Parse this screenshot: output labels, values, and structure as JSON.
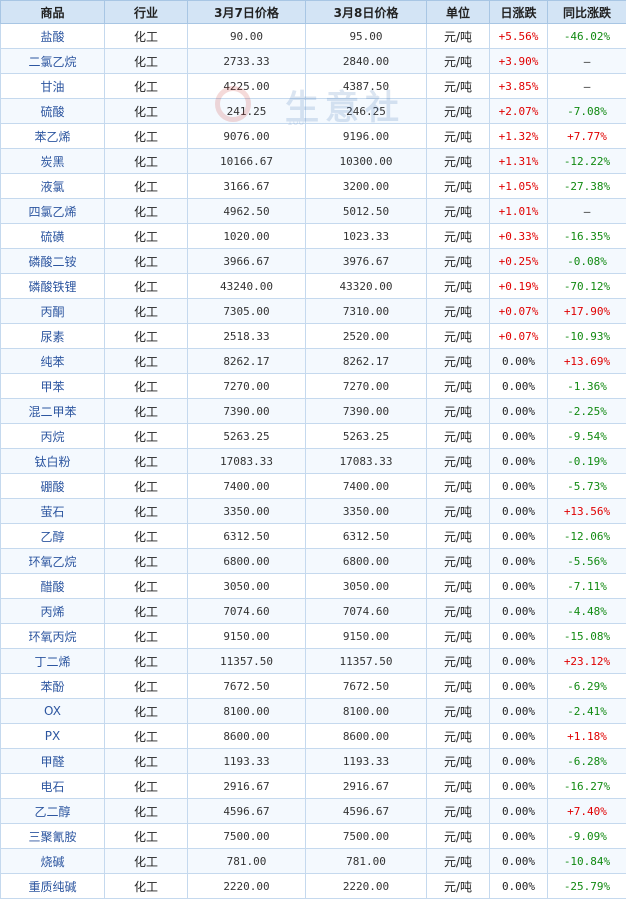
{
  "headers": [
    "商品",
    "行业",
    "3月7日价格",
    "3月8日价格",
    "单位",
    "日涨跌",
    "同比涨跌"
  ],
  "watermark": {
    "text": "生意社",
    "url": "100"
  },
  "rows": [
    {
      "name": "盐酸",
      "industry": "化工",
      "p1": "90.00",
      "p2": "95.00",
      "unit": "元/吨",
      "day": "+5.56%",
      "yoy": "-46.02%"
    },
    {
      "name": "二氯乙烷",
      "industry": "化工",
      "p1": "2733.33",
      "p2": "2840.00",
      "unit": "元/吨",
      "day": "+3.90%",
      "yoy": "—"
    },
    {
      "name": "甘油",
      "industry": "化工",
      "p1": "4225.00",
      "p2": "4387.50",
      "unit": "元/吨",
      "day": "+3.85%",
      "yoy": "—"
    },
    {
      "name": "硫酸",
      "industry": "化工",
      "p1": "241.25",
      "p2": "246.25",
      "unit": "元/吨",
      "day": "+2.07%",
      "yoy": "-7.08%"
    },
    {
      "name": "苯乙烯",
      "industry": "化工",
      "p1": "9076.00",
      "p2": "9196.00",
      "unit": "元/吨",
      "day": "+1.32%",
      "yoy": "+7.77%"
    },
    {
      "name": "炭黑",
      "industry": "化工",
      "p1": "10166.67",
      "p2": "10300.00",
      "unit": "元/吨",
      "day": "+1.31%",
      "yoy": "-12.22%"
    },
    {
      "name": "液氯",
      "industry": "化工",
      "p1": "3166.67",
      "p2": "3200.00",
      "unit": "元/吨",
      "day": "+1.05%",
      "yoy": "-27.38%"
    },
    {
      "name": "四氯乙烯",
      "industry": "化工",
      "p1": "4962.50",
      "p2": "5012.50",
      "unit": "元/吨",
      "day": "+1.01%",
      "yoy": "—"
    },
    {
      "name": "硫磺",
      "industry": "化工",
      "p1": "1020.00",
      "p2": "1023.33",
      "unit": "元/吨",
      "day": "+0.33%",
      "yoy": "-16.35%"
    },
    {
      "name": "磷酸二铵",
      "industry": "化工",
      "p1": "3966.67",
      "p2": "3976.67",
      "unit": "元/吨",
      "day": "+0.25%",
      "yoy": "-0.08%"
    },
    {
      "name": "磷酸铁锂",
      "industry": "化工",
      "p1": "43240.00",
      "p2": "43320.00",
      "unit": "元/吨",
      "day": "+0.19%",
      "yoy": "-70.12%"
    },
    {
      "name": "丙酮",
      "industry": "化工",
      "p1": "7305.00",
      "p2": "7310.00",
      "unit": "元/吨",
      "day": "+0.07%",
      "yoy": "+17.90%"
    },
    {
      "name": "尿素",
      "industry": "化工",
      "p1": "2518.33",
      "p2": "2520.00",
      "unit": "元/吨",
      "day": "+0.07%",
      "yoy": "-10.93%"
    },
    {
      "name": "纯苯",
      "industry": "化工",
      "p1": "8262.17",
      "p2": "8262.17",
      "unit": "元/吨",
      "day": "0.00%",
      "yoy": "+13.69%"
    },
    {
      "name": "甲苯",
      "industry": "化工",
      "p1": "7270.00",
      "p2": "7270.00",
      "unit": "元/吨",
      "day": "0.00%",
      "yoy": "-1.36%"
    },
    {
      "name": "混二甲苯",
      "industry": "化工",
      "p1": "7390.00",
      "p2": "7390.00",
      "unit": "元/吨",
      "day": "0.00%",
      "yoy": "-2.25%"
    },
    {
      "name": "丙烷",
      "industry": "化工",
      "p1": "5263.25",
      "p2": "5263.25",
      "unit": "元/吨",
      "day": "0.00%",
      "yoy": "-9.54%"
    },
    {
      "name": "钛白粉",
      "industry": "化工",
      "p1": "17083.33",
      "p2": "17083.33",
      "unit": "元/吨",
      "day": "0.00%",
      "yoy": "-0.19%"
    },
    {
      "name": "硼酸",
      "industry": "化工",
      "p1": "7400.00",
      "p2": "7400.00",
      "unit": "元/吨",
      "day": "0.00%",
      "yoy": "-5.73%"
    },
    {
      "name": "萤石",
      "industry": "化工",
      "p1": "3350.00",
      "p2": "3350.00",
      "unit": "元/吨",
      "day": "0.00%",
      "yoy": "+13.56%"
    },
    {
      "name": "乙醇",
      "industry": "化工",
      "p1": "6312.50",
      "p2": "6312.50",
      "unit": "元/吨",
      "day": "0.00%",
      "yoy": "-12.06%"
    },
    {
      "name": "环氧乙烷",
      "industry": "化工",
      "p1": "6800.00",
      "p2": "6800.00",
      "unit": "元/吨",
      "day": "0.00%",
      "yoy": "-5.56%"
    },
    {
      "name": "醋酸",
      "industry": "化工",
      "p1": "3050.00",
      "p2": "3050.00",
      "unit": "元/吨",
      "day": "0.00%",
      "yoy": "-7.11%"
    },
    {
      "name": "丙烯",
      "industry": "化工",
      "p1": "7074.60",
      "p2": "7074.60",
      "unit": "元/吨",
      "day": "0.00%",
      "yoy": "-4.48%"
    },
    {
      "name": "环氧丙烷",
      "industry": "化工",
      "p1": "9150.00",
      "p2": "9150.00",
      "unit": "元/吨",
      "day": "0.00%",
      "yoy": "-15.08%"
    },
    {
      "name": "丁二烯",
      "industry": "化工",
      "p1": "11357.50",
      "p2": "11357.50",
      "unit": "元/吨",
      "day": "0.00%",
      "yoy": "+23.12%"
    },
    {
      "name": "苯酚",
      "industry": "化工",
      "p1": "7672.50",
      "p2": "7672.50",
      "unit": "元/吨",
      "day": "0.00%",
      "yoy": "-6.29%"
    },
    {
      "name": "OX",
      "industry": "化工",
      "p1": "8100.00",
      "p2": "8100.00",
      "unit": "元/吨",
      "day": "0.00%",
      "yoy": "-2.41%"
    },
    {
      "name": "PX",
      "industry": "化工",
      "p1": "8600.00",
      "p2": "8600.00",
      "unit": "元/吨",
      "day": "0.00%",
      "yoy": "+1.18%"
    },
    {
      "name": "甲醛",
      "industry": "化工",
      "p1": "1193.33",
      "p2": "1193.33",
      "unit": "元/吨",
      "day": "0.00%",
      "yoy": "-6.28%"
    },
    {
      "name": "电石",
      "industry": "化工",
      "p1": "2916.67",
      "p2": "2916.67",
      "unit": "元/吨",
      "day": "0.00%",
      "yoy": "-16.27%"
    },
    {
      "name": "乙二醇",
      "industry": "化工",
      "p1": "4596.67",
      "p2": "4596.67",
      "unit": "元/吨",
      "day": "0.00%",
      "yoy": "+7.40%"
    },
    {
      "name": "三聚氰胺",
      "industry": "化工",
      "p1": "7500.00",
      "p2": "7500.00",
      "unit": "元/吨",
      "day": "0.00%",
      "yoy": "-9.09%"
    },
    {
      "name": "烧碱",
      "industry": "化工",
      "p1": "781.00",
      "p2": "781.00",
      "unit": "元/吨",
      "day": "0.00%",
      "yoy": "-10.84%"
    },
    {
      "name": "重质纯碱",
      "industry": "化工",
      "p1": "2220.00",
      "p2": "2220.00",
      "unit": "元/吨",
      "day": "0.00%",
      "yoy": "-25.79%"
    }
  ]
}
